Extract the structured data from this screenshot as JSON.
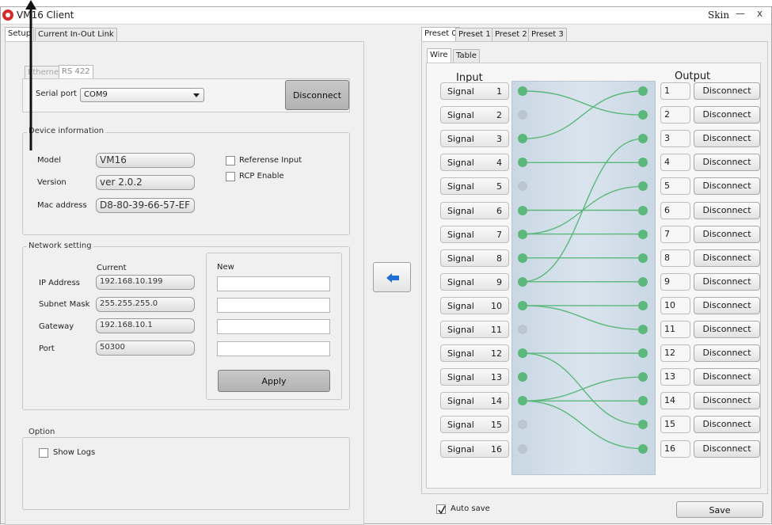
{
  "window": {
    "title": "VM16 Client",
    "skin_label": "Skin",
    "minimize": "—",
    "close": "x"
  },
  "left_tabs": [
    "Setup",
    "Current In-Out Link"
  ],
  "conn_tabs": [
    "Ethernet",
    "RS 422"
  ],
  "connection": {
    "serial_port_label": "Serial port",
    "serial_port_value": "COM9",
    "disconnect_label": "Disconnect"
  },
  "device_info": {
    "title": "Device information",
    "model_label": "Model",
    "model_value": "VM16",
    "version_label": "Version",
    "version_value": "ver 2.0.2",
    "mac_label": "Mac address",
    "mac_value": "D8-80-39-66-57-EF",
    "reference_input_label": "Referense Input",
    "rcp_enable_label": "RCP Enable"
  },
  "network": {
    "title": "Network setting",
    "current_label": "Current",
    "new_label": "New",
    "ip_label": "IP Address",
    "ip_value": "192.168.10.199",
    "subnet_label": "Subnet Mask",
    "subnet_value": "255.255.255.0",
    "gateway_label": "Gateway",
    "gateway_value": "192.168.10.1",
    "port_label": "Port",
    "port_value": "50300",
    "apply_label": "Apply"
  },
  "option": {
    "title": "Option",
    "show_logs_label": "Show Logs"
  },
  "transfer_arrow": "←",
  "preset_tabs": [
    "Preset 0",
    "Preset 1",
    "Preset 2",
    "Preset 3"
  ],
  "view_tabs": [
    "Wire",
    "Table"
  ],
  "wire": {
    "input_header": "Input",
    "output_header": "Output",
    "signal_label": "Signal",
    "output_button_label": "Disconnect",
    "inputs_active": [
      true,
      false,
      true,
      true,
      false,
      true,
      true,
      true,
      true,
      true,
      false,
      true,
      true,
      true,
      false,
      false
    ],
    "routing": [
      {
        "output": 1,
        "input": 3
      },
      {
        "output": 2,
        "input": 1
      },
      {
        "output": 3,
        "input": 9
      },
      {
        "output": 4,
        "input": 4
      },
      {
        "output": 5,
        "input": 7
      },
      {
        "output": 6,
        "input": 6
      },
      {
        "output": 7,
        "input": 7
      },
      {
        "output": 8,
        "input": 8
      },
      {
        "output": 9,
        "input": 9
      },
      {
        "output": 10,
        "input": 10
      },
      {
        "output": 11,
        "input": 10
      },
      {
        "output": 12,
        "input": 12
      },
      {
        "output": 13,
        "input": 14
      },
      {
        "output": 14,
        "input": 14
      },
      {
        "output": 15,
        "input": 12
      },
      {
        "output": 16,
        "input": 14
      }
    ]
  },
  "footer": {
    "auto_save_label": "Auto save",
    "save_label": "Save"
  }
}
